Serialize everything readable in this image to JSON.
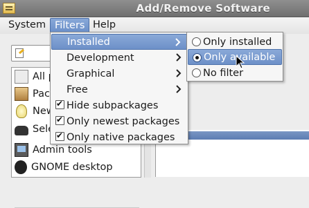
{
  "window": {
    "title": "Add/Remove Software",
    "app_icon": "software-icon"
  },
  "menubar": {
    "items": [
      {
        "label": "System",
        "mnemonic": "S"
      },
      {
        "label": "Filters",
        "mnemonic": "F"
      },
      {
        "label": "Help",
        "mnemonic": "H"
      }
    ]
  },
  "filters_menu": {
    "items": [
      {
        "label": "Installed",
        "type": "submenu",
        "highlighted": true
      },
      {
        "label": "Development",
        "type": "submenu"
      },
      {
        "label": "Graphical",
        "type": "submenu"
      },
      {
        "label": "Free",
        "type": "submenu"
      },
      {
        "label": "Hide subpackages",
        "type": "check",
        "checked": true
      },
      {
        "label": "Only newest packages",
        "type": "check",
        "checked": true
      },
      {
        "label": "Only native packages",
        "type": "check",
        "checked": true
      }
    ]
  },
  "installed_submenu": {
    "items": [
      {
        "label": "Only installed",
        "type": "radio",
        "selected": false
      },
      {
        "label": "Only available",
        "type": "radio",
        "selected": true,
        "highlighted": true
      },
      {
        "label": "No filter",
        "type": "radio",
        "selected": false
      }
    ]
  },
  "groups": {
    "items": [
      {
        "label": "All p",
        "icon": "all-packages-icon"
      },
      {
        "label": "Pac",
        "icon": "package-icon"
      },
      {
        "label": "New",
        "icon": "lightbulb-icon"
      },
      {
        "label": "Sele",
        "icon": "binoculars-icon"
      },
      {
        "label": "Admin tools",
        "icon": "admin-tools-icon"
      },
      {
        "label": "GNOME desktop",
        "icon": "gnome-foot-icon"
      }
    ]
  },
  "colors": {
    "highlight": "#6d90c8",
    "titlebar": "#7f7f7f"
  }
}
